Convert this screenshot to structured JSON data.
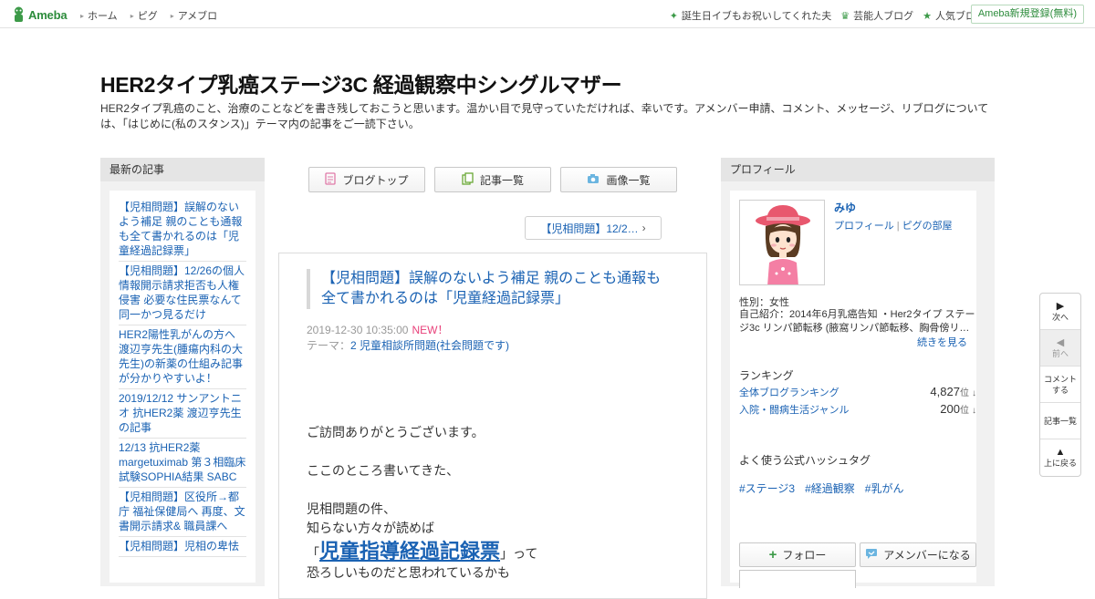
{
  "topbar": {
    "logo": "Ameba",
    "nav": [
      "ホーム",
      "ピグ",
      "アメブロ"
    ],
    "right_links": [
      {
        "icon": "star-icon",
        "label": "誕生日イブもお祝いしてくれた夫"
      },
      {
        "icon": "crown-icon",
        "label": "芸能人ブログ"
      },
      {
        "icon": "star-icon",
        "label": "人気ブログ"
      }
    ],
    "register": "Ameba新規登録(無料)"
  },
  "header": {
    "title": "HER2タイプ乳癌ステージ3C 経過観察中シングルマザー",
    "description": "HER2タイプ乳癌のこと、治療のことなどを書き残しておこうと思います。温かい目で見守っていただければ、幸いです。アメンバー申請、コメント、メッセージ、リブログについては、「はじめに(私のスタンス)」テーマ内の記事をご一読下さい。"
  },
  "left": {
    "heading": "最新の記事",
    "items": [
      "【児相問題】誤解のないよう補足 親のことも通報も全て書かれるのは「児童経過記録票」",
      "【児相問題】12/26の個人情報開示請求拒否も人権侵害 必要な住民票なんて同一かつ見るだけ",
      "HER2陽性乳がんの方へ 渡辺亨先生(腫瘍内科の大先生)の新薬の仕組み記事が分かりやすいよ！",
      "2019/12/12 サンアントニオ 抗HER2薬 渡辺亨先生の記事",
      "12/13 抗HER2薬 margetuximab 第３相臨床試験SOPHIA結果 SABC",
      "【児相問題】区役所→都庁 福祉保健局へ 再度、文書開示請求& 職員課へ",
      "【児相問題】児相の卑怯"
    ]
  },
  "tabs": [
    {
      "icon": "document-icon",
      "label": "ブログトップ"
    },
    {
      "icon": "copy-icon",
      "label": "記事一覧"
    },
    {
      "icon": "camera-icon",
      "label": "画像一覧"
    }
  ],
  "next_entry": "【児相問題】12/2…",
  "article": {
    "title": "【児相問題】誤解のないよう補足 親のことも通報も全て書かれるのは「児童経過記録票」",
    "date": "2019-12-30 10:35:00",
    "new_badge": "NEW！",
    "theme_label": "テーマ：",
    "theme": "2 児童相談所問題(社会問題です)",
    "body": {
      "p1": "ご訪問ありがとうございます。",
      "p2": "ここのところ書いてきた、",
      "p3": "児相問題の件、",
      "p4": "知らない方々が読めば",
      "p5_open": "「",
      "p5_link": "児童指導経過記録票",
      "p5_close": "」って",
      "p6": "恐ろしいものだと思われているかも"
    }
  },
  "profile": {
    "heading": "プロフィール",
    "name": "みゆ",
    "link_profile": "プロフィール",
    "link_pig": "ピグの部屋",
    "link_sep": "|",
    "gender": "性別：女性",
    "intro": "自己紹介：2014年6月乳癌告知 ・Her2タイプ ステージ3c リンパ節転移 (腋窩リンパ節転移、胸骨傍リ…",
    "readmore": "続きを見る",
    "ranking_heading": "ランキング",
    "rankings": [
      {
        "label": "全体ブログランキング",
        "value": "4,827",
        "unit": "位",
        "trend": "↓"
      },
      {
        "label": "入院・闘病生活ジャンル",
        "value": "200",
        "unit": "位",
        "trend": "↓"
      }
    ],
    "hashtag_heading": "よく使う公式ハッシュタグ",
    "hashtags": [
      "#ステージ3",
      "#経過観察",
      "#乳がん"
    ],
    "buttons": [
      {
        "icon": "plus-icon",
        "label": "フォロー"
      },
      {
        "icon": "amember-icon",
        "label": "アメンバーになる"
      }
    ]
  },
  "sidenav": [
    {
      "icon": "triangle-right-icon",
      "label": "次へ",
      "enabled": true
    },
    {
      "icon": "triangle-left-icon",
      "label": "前へ",
      "enabled": false
    },
    {
      "icon": "",
      "label": "コメントする",
      "enabled": true
    },
    {
      "icon": "",
      "label": "記事一覧",
      "enabled": true
    },
    {
      "icon": "triangle-up-icon",
      "label": "上に戻る",
      "enabled": true
    }
  ],
  "colors": {
    "brand_green": "#2d8c3c",
    "link_blue": "#1a62b3",
    "new_pink": "#e8417a"
  }
}
